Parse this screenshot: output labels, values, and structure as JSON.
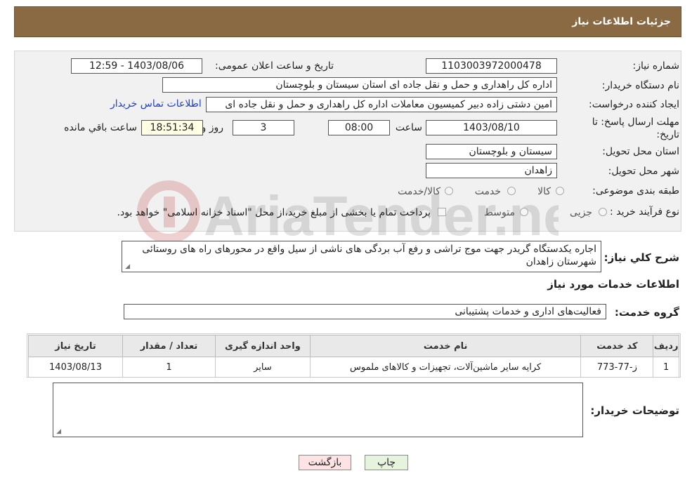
{
  "header": {
    "title": "جزئیات اطلاعات نیاز"
  },
  "fields": {
    "need_number_label": "شماره نیاز:",
    "need_number": "1103003972000478",
    "announce_label": "تاریخ و ساعت اعلان عمومی:",
    "announce_value": "1403/08/06 - 12:59",
    "buyer_org_label": "نام دستگاه خریدار:",
    "buyer_org": "اداره کل راهداری و حمل و نقل جاده ای استان سیستان و بلوچستان",
    "creator_label": "ایجاد کننده درخواست:",
    "creator": "امین دشتی زاده دبیر کمیسیون معاملات اداره کل راهداری و حمل و نقل جاده ای",
    "contact_link": "اطلاعات تماس خریدار",
    "deadline_label_1": "مهلت ارسال پاسخ: تا",
    "deadline_label_2": "تاریخ:",
    "deadline_date": "1403/08/10",
    "time_label": "ساعت",
    "deadline_time": "08:00",
    "days_value": "3",
    "days_label": "روز و",
    "remaining_time": "18:51:34",
    "remaining_label": "ساعت باقي مانده",
    "province_label": "استان محل تحویل:",
    "province": "سیستان و بلوچستان",
    "city_label": "شهر محل تحویل:",
    "city": "زاهدان",
    "category_label": "طبقه بندی موضوعی:",
    "category_options": [
      "کالا",
      "خدمت",
      "کالا/خدمت"
    ],
    "process_label": "نوع فرآیند خرید :",
    "process_options": [
      "جزیی",
      "متوسط"
    ],
    "payment_note": "پرداخت تمام یا بخشی از مبلغ خرید،از محل \"اسناد خزانه اسلامی\" خواهد بود."
  },
  "description": {
    "label": "شرح کلي نياز:",
    "text": "اجاره یکدستگاه گریدر جهت موج تراشی و رفع آب بردگی های ناشی از سیل واقع در محورهای راه های روستائی شهرستان زاهدان"
  },
  "services": {
    "section_title": "اطلاعات خدمات مورد نياز",
    "group_label": "گروه خدمت:",
    "group_value": "فعالیت‌های اداری و خدمات پشتیبانی",
    "columns": [
      "ردیف",
      "کد خدمت",
      "نام خدمت",
      "واحد اندازه گیری",
      "تعداد / مقدار",
      "تاریخ نیاز"
    ],
    "rows": [
      [
        "1",
        "ز-77-773",
        "کرایه سایر ماشین‌آلات، تجهیزات و کالاهای ملموس",
        "سایر",
        "1",
        "1403/08/13"
      ]
    ]
  },
  "buyer_notes": {
    "label": "توضیحات خریدار:",
    "text": ""
  },
  "buttons": {
    "print": "چاپ",
    "back": "بازگشت"
  },
  "watermark": {
    "text": "AriaTender.neT"
  }
}
